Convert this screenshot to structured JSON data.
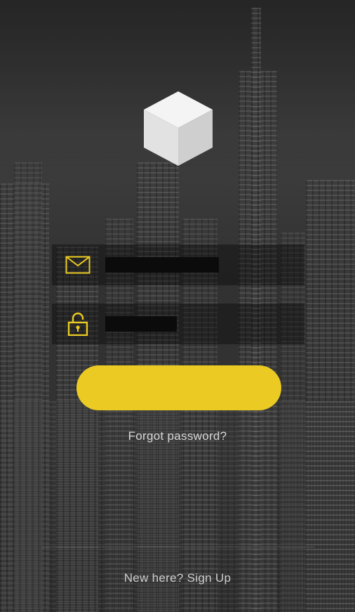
{
  "app": {
    "logo_icon": "white-cube-icon",
    "accent_color": "#ebcb23"
  },
  "form": {
    "email": {
      "icon": "envelope-icon",
      "value": "",
      "placeholder": ""
    },
    "password": {
      "icon": "padlock-icon",
      "value": "",
      "placeholder": ""
    },
    "login_button_label": ""
  },
  "links": {
    "forgot_password": "Forgot password?",
    "sign_up": "New here? Sign Up"
  },
  "background": {
    "description_icon": "city-skyline-background"
  }
}
